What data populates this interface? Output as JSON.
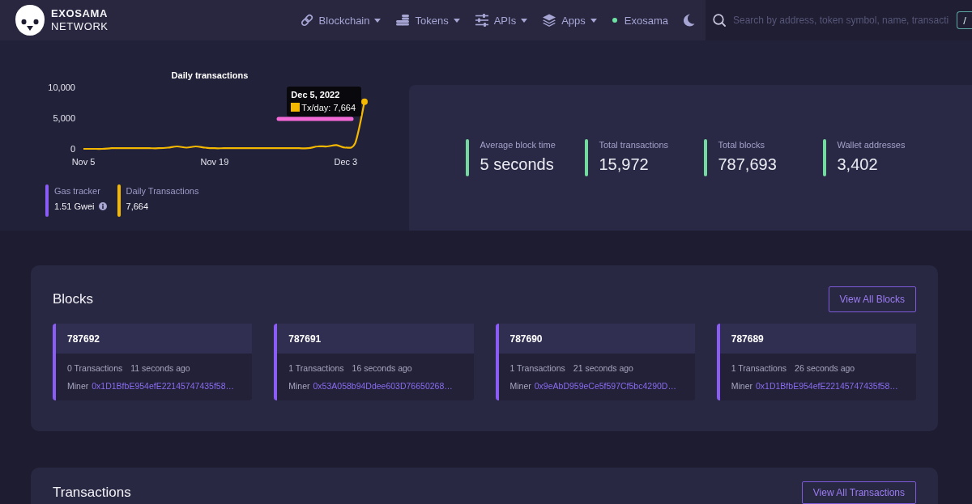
{
  "logo": {
    "title": "EXOSAMA",
    "subtitle": "NETWORK"
  },
  "nav": [
    {
      "kind": "link",
      "label": "Blockchain",
      "dropdown": true
    },
    {
      "kind": "coins",
      "label": "Tokens",
      "dropdown": true
    },
    {
      "kind": "sliders",
      "label": "APIs",
      "dropdown": true
    },
    {
      "kind": "layers",
      "label": "Apps",
      "dropdown": true
    },
    {
      "kind": "network",
      "label": "Exosama",
      "dropdown": false
    }
  ],
  "search": {
    "placeholder": "Search by address, token symbol, name, transacti",
    "shortcut": "/"
  },
  "daily_chart": {
    "chart_data": {
      "type": "line",
      "title": "Daily transactions",
      "categories": [
        "Nov 5",
        null,
        null,
        null,
        null,
        null,
        null,
        null,
        null,
        null,
        null,
        null,
        null,
        null,
        "Nov 19",
        null,
        null,
        null,
        null,
        null,
        null,
        null,
        null,
        null,
        null,
        null,
        null,
        null,
        "Dec 3",
        null,
        null
      ],
      "series": [
        {
          "color": "#f5b800",
          "values": [
            0,
            0,
            0,
            100,
            100,
            100,
            100,
            100,
            100,
            200,
            400,
            200,
            400,
            200,
            100,
            100,
            100,
            100,
            100,
            100,
            100,
            100,
            100,
            100,
            100,
            400,
            400,
            600,
            200,
            900,
            7664
          ]
        }
      ],
      "ylim": [
        0,
        10000
      ],
      "yticks": [
        {
          "value": 0,
          "label": "0"
        },
        {
          "value": 5000,
          "label": "5,000"
        },
        {
          "value": 10000,
          "label": "10,000"
        }
      ]
    },
    "tooltip": {
      "title": "Dec 5, 2022",
      "label": "Tx/day: 7,664",
      "underlined": true
    }
  },
  "chart_stats": [
    {
      "label": "Gas tracker",
      "value": "1.51 Gwei",
      "color": "#8b5cf6",
      "info": true
    },
    {
      "label": "Daily Transactions",
      "value": "7,664",
      "color": "#f5b800",
      "info": false
    }
  ],
  "stats": [
    {
      "label": "Average block time",
      "value": "5 seconds"
    },
    {
      "label": "Total transactions",
      "value": "15,972"
    },
    {
      "label": "Total blocks",
      "value": "787,693"
    },
    {
      "label": "Wallet addresses",
      "value": "3,402"
    }
  ],
  "blocks": {
    "title": "Blocks",
    "button": "View All Blocks",
    "items": [
      {
        "number": "787692",
        "transactions": "0 Transactions",
        "age": "11 seconds ago",
        "miner_label": "Miner",
        "miner": "0x1D1BfbE954efE22145747435f58…"
      },
      {
        "number": "787691",
        "transactions": "1 Transactions",
        "age": "16 seconds ago",
        "miner_label": "Miner",
        "miner": "0x53A058b94Ddee603D76650268…"
      },
      {
        "number": "787690",
        "transactions": "1 Transactions",
        "age": "21 seconds ago",
        "miner_label": "Miner",
        "miner": "0x9eAbD959eCe5f597Cf5bc4290D…"
      },
      {
        "number": "787689",
        "transactions": "1 Transactions",
        "age": "26 seconds ago",
        "miner_label": "Miner",
        "miner": "0x1D1BfbE954efE22145747435f58…"
      }
    ]
  },
  "transactions": {
    "title": "Transactions",
    "button": "View All Transactions"
  }
}
